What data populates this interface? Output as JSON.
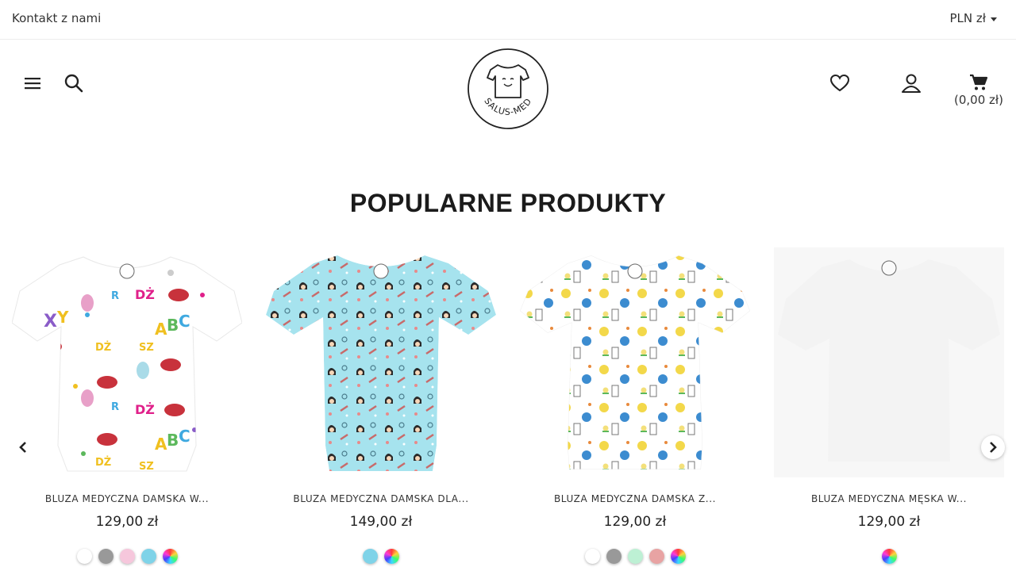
{
  "topbar": {
    "contact_label": "Kontakt z nami",
    "currency_label": "PLN zł"
  },
  "header": {
    "logo_text": "SALUS-MED",
    "cart_total": "(0,00 zł)"
  },
  "section": {
    "title": "POPULARNE PRODUKTY"
  },
  "products": [
    {
      "name": "BLUZA MEDYCZNA DAMSKA W...",
      "price": "129,00 zł",
      "print": "letters-pattern",
      "swatches": [
        "#ffffff",
        "#999999",
        "#f6c7dc",
        "#7fd3e8",
        "multicolor"
      ]
    },
    {
      "name": "BLUZA MEDYCZNA DAMSKA DLA...",
      "price": "149,00 zł",
      "print": "medical-pattern-blue",
      "swatches": [
        "#7fd3e8",
        "multicolor"
      ]
    },
    {
      "name": "BLUZA MEDYCZNA DAMSKA Z...",
      "price": "129,00 zł",
      "print": "kids-pattern",
      "swatches": [
        "#ffffff",
        "#999999",
        "#bdf0d4",
        "#e8a3a3",
        "multicolor"
      ]
    },
    {
      "name": "BLUZA MEDYCZNA MĘSKA W...",
      "price": "129,00 zł",
      "print": "plain-grey",
      "swatches": [
        "multicolor"
      ]
    }
  ],
  "colors": {
    "text": "#222222",
    "divider": "#ececec",
    "blue_print": "#a6e3ee",
    "plain_shirt": "#f3f3f3"
  }
}
